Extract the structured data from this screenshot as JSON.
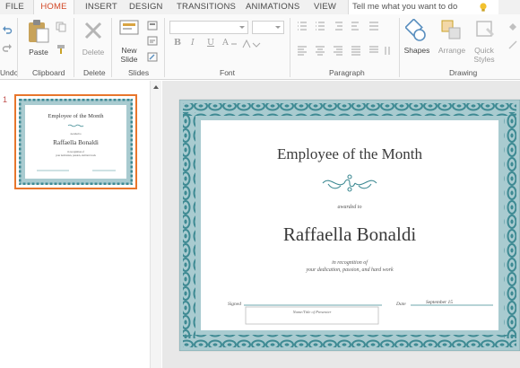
{
  "tabs": [
    {
      "label": "FILE",
      "active": false
    },
    {
      "label": "HOME",
      "active": true
    },
    {
      "label": "INSERT",
      "active": false
    },
    {
      "label": "DESIGN",
      "active": false
    },
    {
      "label": "TRANSITIONS",
      "active": false
    },
    {
      "label": "ANIMATIONS",
      "active": false
    },
    {
      "label": "VIEW",
      "active": false
    }
  ],
  "tell_me": {
    "placeholder": "Tell me what you want to do"
  },
  "ribbon": {
    "undo": {
      "group_label": "Undo"
    },
    "clipboard": {
      "paste_label": "Paste",
      "group_label": "Clipboard"
    },
    "delete": {
      "delete_label": "Delete",
      "group_label": "Delete"
    },
    "slides": {
      "new_slide_line1": "New",
      "new_slide_line2": "Slide",
      "group_label": "Slides"
    },
    "font": {
      "group_label": "Font",
      "bold": "B",
      "italic": "I",
      "underline": "U",
      "font_color": "A",
      "font_name": "",
      "font_size": ""
    },
    "paragraph": {
      "group_label": "Paragraph"
    },
    "drawing": {
      "shapes_label": "Shapes",
      "arrange_label": "Arrange",
      "quick_styles_line1": "Quick",
      "quick_styles_line2": "Styles",
      "group_label": "Drawing"
    }
  },
  "thumbnails": [
    {
      "number": "1",
      "selected": true
    }
  ],
  "slide": {
    "title": "Employee of the Month",
    "awarded_to": "awarded to",
    "recipient": "Raffaella Bonaldi",
    "recognition_line1": "in recognition of",
    "recognition_line2": "your dedication, passion, and hard work",
    "signed_label": "Signed",
    "presenter_placeholder": "Name/Title of Presenter",
    "date_label": "Date",
    "date_value": "September 15"
  },
  "colors": {
    "accent": "#d24726",
    "selection": "#e8762c",
    "frame_fill": "#a9cbd0",
    "chain": "#3e8a93",
    "title_text": "#3a3a3a"
  }
}
